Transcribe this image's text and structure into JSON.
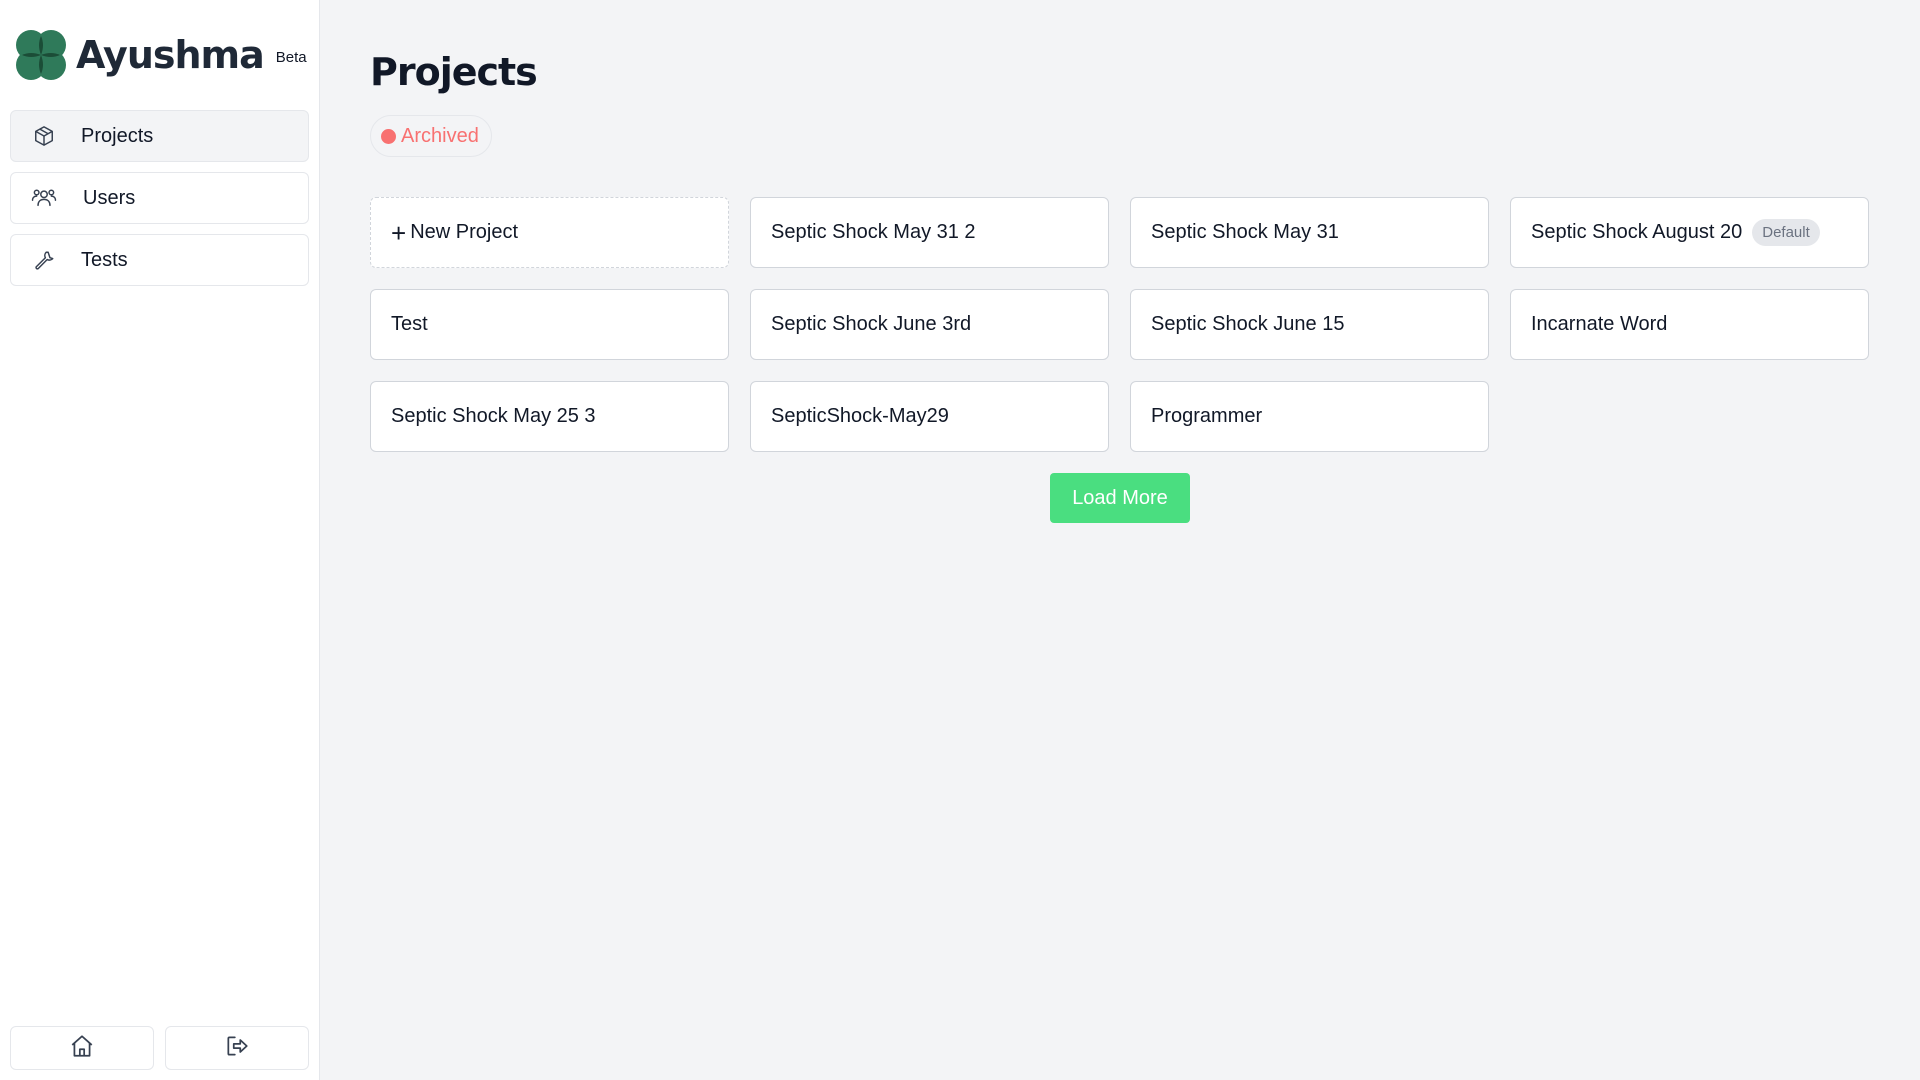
{
  "brand": {
    "name": "Ayushma",
    "badge": "Beta",
    "logo_color": "#2e7d5b"
  },
  "sidebar": {
    "items": [
      {
        "label": "Projects",
        "icon": "cube-icon",
        "active": true
      },
      {
        "label": "Users",
        "icon": "users-icon",
        "active": false
      },
      {
        "label": "Tests",
        "icon": "wrench-icon",
        "active": false
      }
    ],
    "bottom": [
      {
        "icon": "home-icon"
      },
      {
        "icon": "logout-icon"
      }
    ]
  },
  "main": {
    "title": "Projects",
    "filter": {
      "label": "Archived",
      "dot_color": "#f87171"
    },
    "new_project": {
      "label": "New Project",
      "icon": "plus-icon"
    },
    "projects": [
      {
        "name": "Septic Shock May 31 2"
      },
      {
        "name": "Septic Shock May 31"
      },
      {
        "name": "Septic Shock August 20",
        "badge": "Default"
      },
      {
        "name": "Test"
      },
      {
        "name": "Septic Shock June 3rd"
      },
      {
        "name": "Septic Shock June 15"
      },
      {
        "name": "Incarnate Word"
      },
      {
        "name": "Septic Shock May 25 3"
      },
      {
        "name": "SepticShock-May29"
      },
      {
        "name": "Programmer"
      }
    ],
    "load_more_label": "Load More",
    "accent_color": "#4ade80"
  }
}
